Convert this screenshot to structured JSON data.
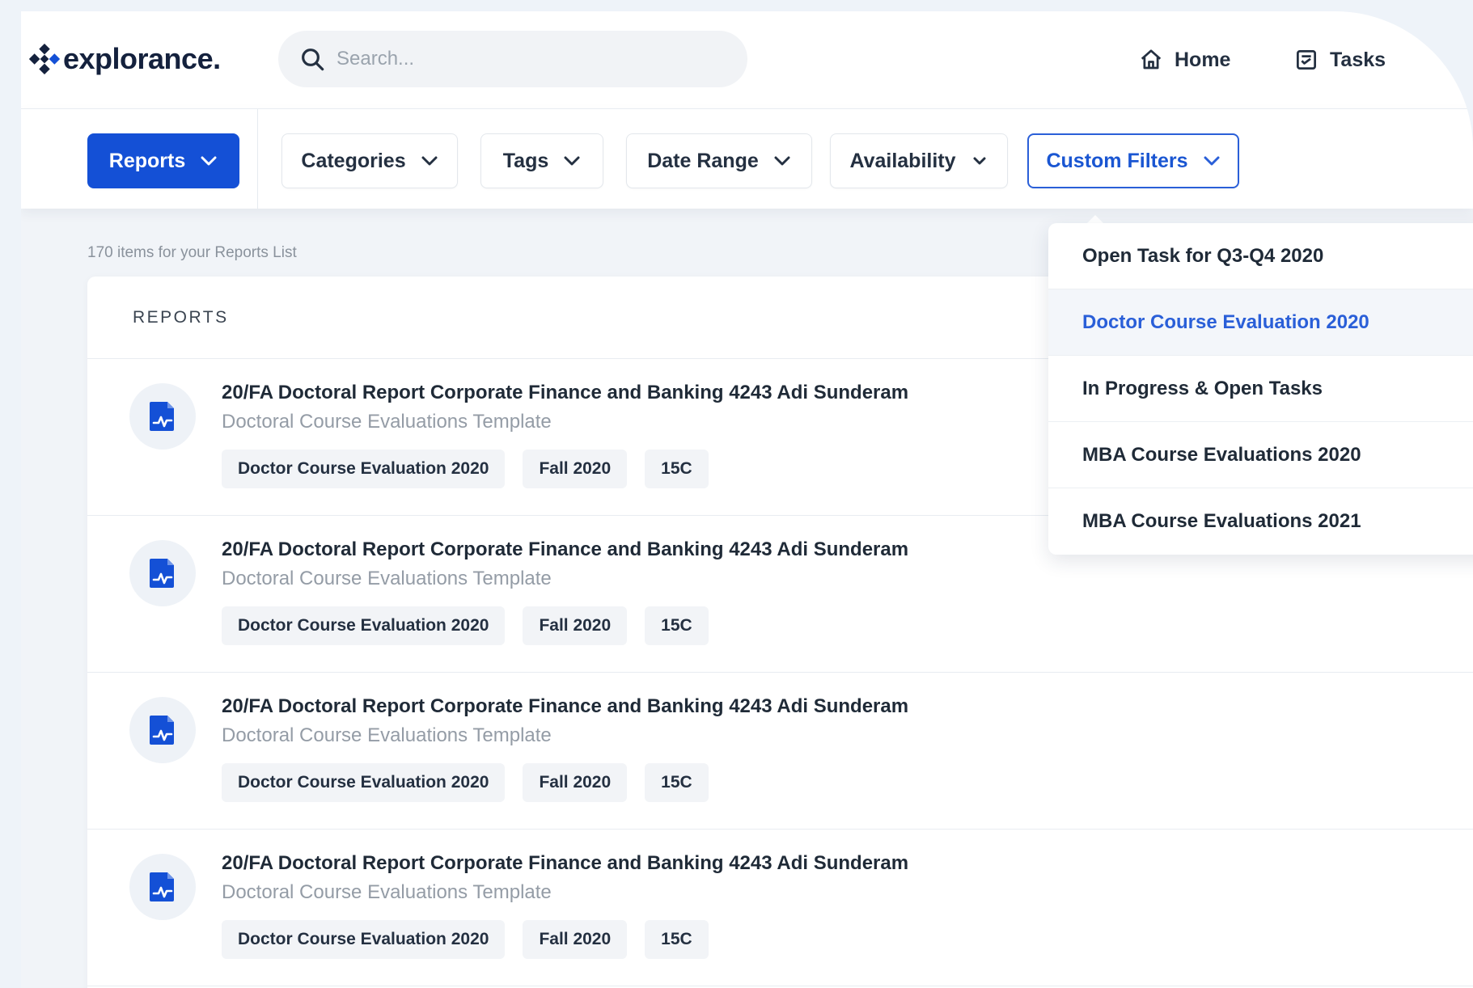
{
  "brand": {
    "name": "explorance."
  },
  "search": {
    "placeholder": "Search..."
  },
  "nav": {
    "home_label": "Home",
    "tasks_label": "Tasks"
  },
  "filters": {
    "reports_label": "Reports",
    "categories_label": "Categories",
    "tags_label": "Tags",
    "date_range_label": "Date Range",
    "availability_label": "Availability",
    "custom_filters_label": "Custom Filters"
  },
  "list": {
    "count_text": "170 items for your Reports List",
    "header": "REPORTS",
    "rows": [
      {
        "title": "20/FA Doctoral Report Corporate Finance and Banking 4243 Adi Sunderam",
        "subtitle": "Doctoral Course Evaluations Template",
        "tags": [
          "Doctor Course Evaluation 2020",
          "Fall 2020",
          "15C"
        ]
      },
      {
        "title": "20/FA Doctoral Report Corporate Finance and Banking 4243 Adi Sunderam",
        "subtitle": "Doctoral Course Evaluations Template",
        "tags": [
          "Doctor Course Evaluation 2020",
          "Fall 2020",
          "15C"
        ]
      },
      {
        "title": "20/FA Doctoral Report Corporate Finance and Banking 4243 Adi Sunderam",
        "subtitle": "Doctoral Course Evaluations Template",
        "tags": [
          "Doctor Course Evaluation 2020",
          "Fall 2020",
          "15C"
        ]
      },
      {
        "title": "20/FA Doctoral Report Corporate Finance and Banking 4243 Adi Sunderam",
        "subtitle": "Doctoral Course Evaluations Template",
        "tags": [
          "Doctor Course Evaluation 2020",
          "Fall 2020",
          "15C"
        ]
      }
    ]
  },
  "custom_filters_menu": {
    "items": [
      {
        "label": "Open Task for Q3-Q4 2020",
        "active": false
      },
      {
        "label": "Doctor Course Evaluation 2020",
        "active": true
      },
      {
        "label": "In Progress & Open Tasks",
        "active": false
      },
      {
        "label": "MBA Course Evaluations 2020",
        "active": false
      },
      {
        "label": "MBA Course Evaluations 2021",
        "active": false
      }
    ]
  },
  "icons": {
    "logo": "explorance-logo-icon",
    "search": "search-icon",
    "home": "home-icon",
    "tasks": "tasks-icon",
    "dropdown": "chevron-down-icon",
    "report": "report-file-icon"
  },
  "colors": {
    "primary": "#1450d6",
    "active_text": "#2a5fd8",
    "page_bg": "#eef3f9",
    "text_dark": "#1f2a37",
    "text_muted": "#949ca6"
  }
}
